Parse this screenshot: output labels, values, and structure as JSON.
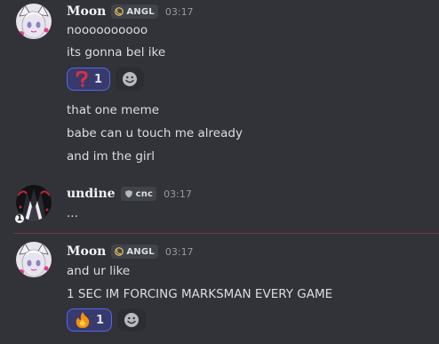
{
  "messages": [
    {
      "username": "Moon",
      "tag": "ANGL",
      "timestamp": "03:17",
      "lines": [
        "noooooooooo",
        "its gonna bel ike"
      ],
      "reactions": [
        {
          "emoji": "question-mark",
          "count": "1"
        }
      ],
      "continued_lines": [
        "that one meme",
        "babe can u touch me already",
        "and im the girl"
      ]
    },
    {
      "username": "undine",
      "tag": "cnc",
      "timestamp": "03:17",
      "lines": [
        "..."
      ],
      "avatar_badge": "1"
    },
    {
      "username": "Moon",
      "tag": "ANGL",
      "timestamp": "03:17",
      "lines": [
        "and ur like",
        "1 SEC IM FORCING MARKSMAN EVERY GAME"
      ],
      "reactions": [
        {
          "emoji": "fire",
          "count": "1"
        }
      ]
    }
  ],
  "colors": {
    "background": "#313338",
    "reaction_active_bg": "#373a6b",
    "reaction_active_border": "#5865f2",
    "new_messages_divider": "#7a3a44"
  }
}
